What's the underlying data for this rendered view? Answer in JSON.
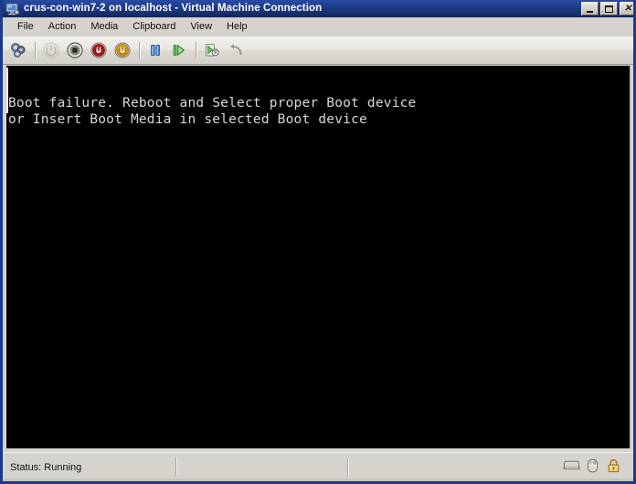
{
  "window": {
    "title": "crus-con-win7-2 on localhost - Virtual Machine Connection",
    "icon": "vm-computer-icon",
    "titlebar_color": "#1f3d8f",
    "controls": {
      "minimize_label": "–",
      "maximize_label": "□",
      "close_label": "✕"
    }
  },
  "menubar": {
    "items": [
      {
        "label": "File",
        "name": "menu-file"
      },
      {
        "label": "Action",
        "name": "menu-action"
      },
      {
        "label": "Media",
        "name": "menu-media"
      },
      {
        "label": "Clipboard",
        "name": "menu-clipboard"
      },
      {
        "label": "View",
        "name": "menu-view"
      },
      {
        "label": "Help",
        "name": "menu-help"
      }
    ]
  },
  "toolbar": {
    "buttons": [
      {
        "name": "ctrl-alt-delete-icon",
        "label": "Ctrl+Alt+Delete",
        "enabled": true
      },
      {
        "name": "start-icon",
        "label": "Start",
        "enabled": false
      },
      {
        "name": "shut-down-icon",
        "label": "Shut Down",
        "enabled": true
      },
      {
        "name": "turn-off-icon",
        "label": "Turn Off",
        "enabled": true
      },
      {
        "name": "reset-icon",
        "label": "Reset",
        "enabled": true
      },
      {
        "name": "pause-icon",
        "label": "Pause",
        "enabled": true
      },
      {
        "name": "resume-icon",
        "label": "Resume",
        "enabled": true
      },
      {
        "name": "snapshot-icon",
        "label": "Snapshot",
        "enabled": true
      },
      {
        "name": "revert-icon",
        "label": "Revert",
        "enabled": true
      }
    ]
  },
  "console": {
    "background_color": "#000000",
    "text_color": "#d8d8d8",
    "lines": [
      "Boot failure. Reboot and Select proper Boot device",
      "or Insert Boot Media in selected Boot device"
    ],
    "text": "Boot failure. Reboot and Select proper Boot device\nor Insert Boot Media in selected Boot device"
  },
  "statusbar": {
    "status": "Status: Running",
    "icons": [
      {
        "name": "keyboard-icon",
        "label": "Keyboard"
      },
      {
        "name": "mouse-icon",
        "label": "Mouse"
      },
      {
        "name": "lock-icon",
        "label": "Locked"
      }
    ]
  }
}
